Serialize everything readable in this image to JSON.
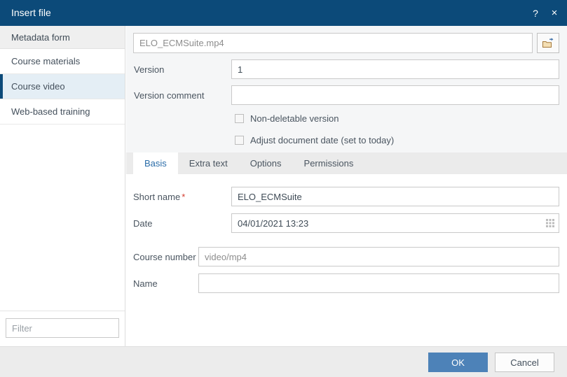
{
  "titlebar": {
    "title": "Insert file",
    "help_icon": "?",
    "close_icon": "×"
  },
  "sidebar": {
    "header": "Metadata form",
    "items": [
      {
        "label": "Course materials",
        "selected": false
      },
      {
        "label": "Course video",
        "selected": true
      },
      {
        "label": "Web-based training",
        "selected": false
      }
    ],
    "filter": {
      "value": "",
      "placeholder": "Filter"
    }
  },
  "top_section": {
    "file": {
      "value": "ELO_ECMSuite.mp4",
      "placeholder": "",
      "browse_icon": "open-folder-icon"
    },
    "version": {
      "label": "Version",
      "value": "1",
      "placeholder": ""
    },
    "version_comment": {
      "label": "Version comment",
      "value": "",
      "placeholder": ""
    },
    "checkboxes": [
      {
        "label": "Non-deletable version",
        "checked": false
      },
      {
        "label": "Adjust document date (set to today)",
        "checked": false
      }
    ]
  },
  "tabs": [
    {
      "label": "Basis",
      "active": true
    },
    {
      "label": "Extra text",
      "active": false
    },
    {
      "label": "Options",
      "active": false
    },
    {
      "label": "Permissions",
      "active": false
    }
  ],
  "basis_panel": {
    "short_name": {
      "label": "Short name",
      "required_marker": "*",
      "value": "ELO_ECMSuite",
      "placeholder": ""
    },
    "date": {
      "label": "Date",
      "value": "04/01/2021 13:23",
      "placeholder": "",
      "icon": "calendar-icon"
    },
    "course_number": {
      "label": "Course number",
      "value": "video/mp4",
      "placeholder": ""
    },
    "name": {
      "label": "Name",
      "value": "",
      "placeholder": ""
    }
  },
  "footer": {
    "ok_label": "OK",
    "cancel_label": "Cancel"
  },
  "colors": {
    "titlebar": "#0c4a79",
    "accent": "#4d82b8",
    "selected_item_bg": "#e4eef5",
    "selected_item_border": "#0c4a79",
    "required_marker": "#d33b2e",
    "active_tab_text": "#2a6ca8"
  }
}
